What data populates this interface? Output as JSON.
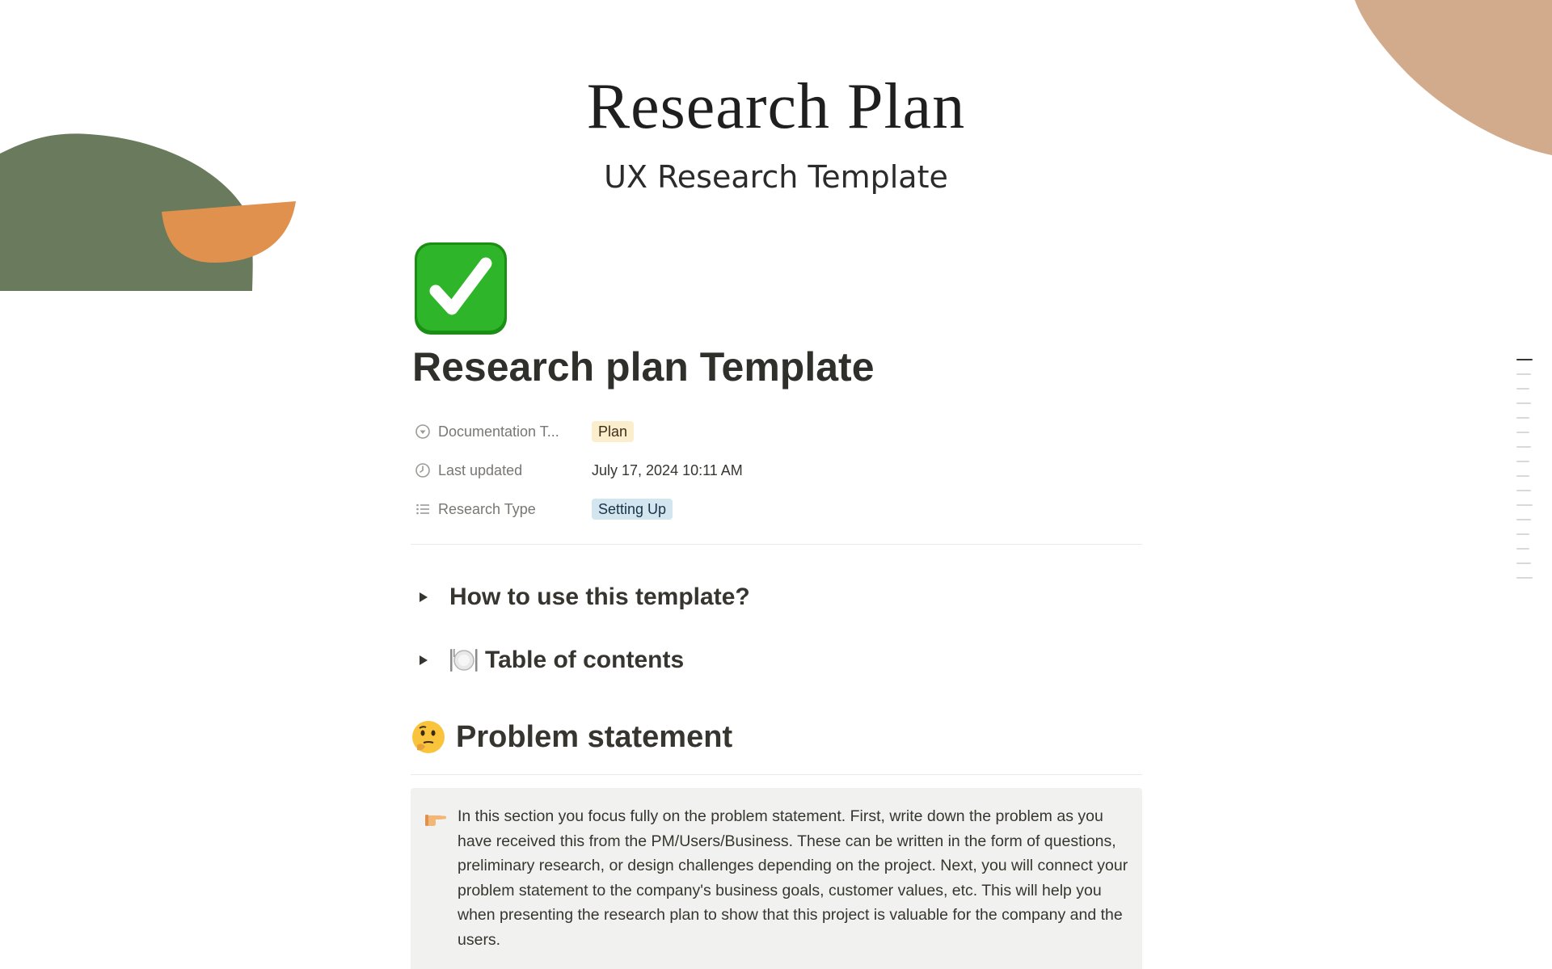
{
  "cover": {
    "title": "Research Plan",
    "subtitle": "UX Research Template"
  },
  "page": {
    "icon": "white-check-mark-icon",
    "title": "Research plan Template"
  },
  "properties": [
    {
      "icon": "select-icon",
      "key": "Documentation T...",
      "value": "Plan",
      "type": "tag",
      "color": "#fbeecc"
    },
    {
      "icon": "clock-icon",
      "key": "Last updated",
      "value": "July 17, 2024 10:11 AM",
      "type": "text"
    },
    {
      "icon": "list-icon",
      "key": "Research Type",
      "value": "Setting Up",
      "type": "tag",
      "color": "#d3e5ef"
    }
  ],
  "toggles": [
    {
      "label": "How to use this template?"
    },
    {
      "label": "Table of contents",
      "icon": "plate-cutlery-icon"
    }
  ],
  "section": {
    "icon": "thinking-face-icon",
    "heading": "Problem statement"
  },
  "callout": {
    "icon": "pointing-hand-icon",
    "text": "In this section you focus fully on the problem statement. First, write down the problem as you have received this from the PM/Users/Business. These can be written in the form of questions, preliminary research, or design challenges depending on the project. Next, you will connect your problem statement to the company's business goals, customer values, etc. This will help you when presenting the research plan to show that this project is valuable for the company and the users."
  },
  "colors": {
    "deco_green": "#6a7a5c",
    "deco_orange": "#e0914e",
    "deco_tan": "#d2ab8d",
    "check_green": "#2fb52a"
  }
}
